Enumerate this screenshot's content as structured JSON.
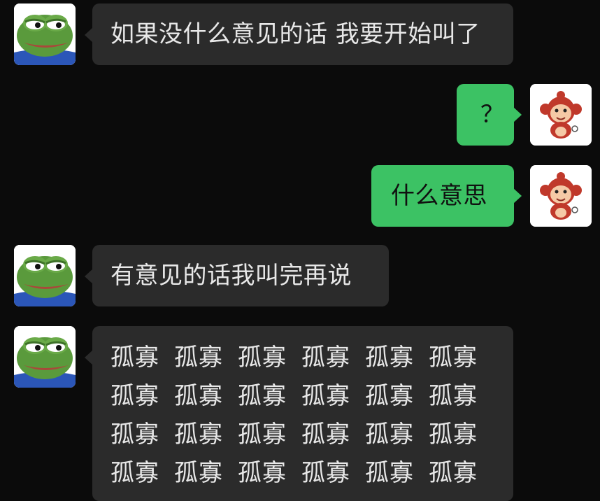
{
  "messages": [
    {
      "sender": "other",
      "avatar": "pepe-frog-avatar",
      "text": "如果没什么意见的话 我要开始叫了"
    },
    {
      "sender": "self",
      "avatar": "monkey-avatar",
      "text": "？"
    },
    {
      "sender": "self",
      "avatar": "monkey-avatar",
      "text": "什么意思"
    },
    {
      "sender": "other",
      "avatar": "pepe-frog-avatar",
      "text": "有意见的话我叫完再说"
    },
    {
      "sender": "other",
      "avatar": "pepe-frog-avatar",
      "words": [
        "孤寡",
        "孤寡",
        "孤寡",
        "孤寡",
        "孤寡",
        "孤寡",
        "孤寡",
        "孤寡",
        "孤寡",
        "孤寡",
        "孤寡",
        "孤寡",
        "孤寡",
        "孤寡",
        "孤寡",
        "孤寡",
        "孤寡",
        "孤寡",
        "孤寡",
        "孤寡",
        "孤寡",
        "孤寡",
        "孤寡",
        "孤寡"
      ]
    }
  ],
  "colors": {
    "background": "#0b0b0b",
    "incoming_bubble": "#2b2b2b",
    "outgoing_bubble": "#3cc264",
    "incoming_text": "#e8e8e8",
    "outgoing_text": "#101010"
  }
}
